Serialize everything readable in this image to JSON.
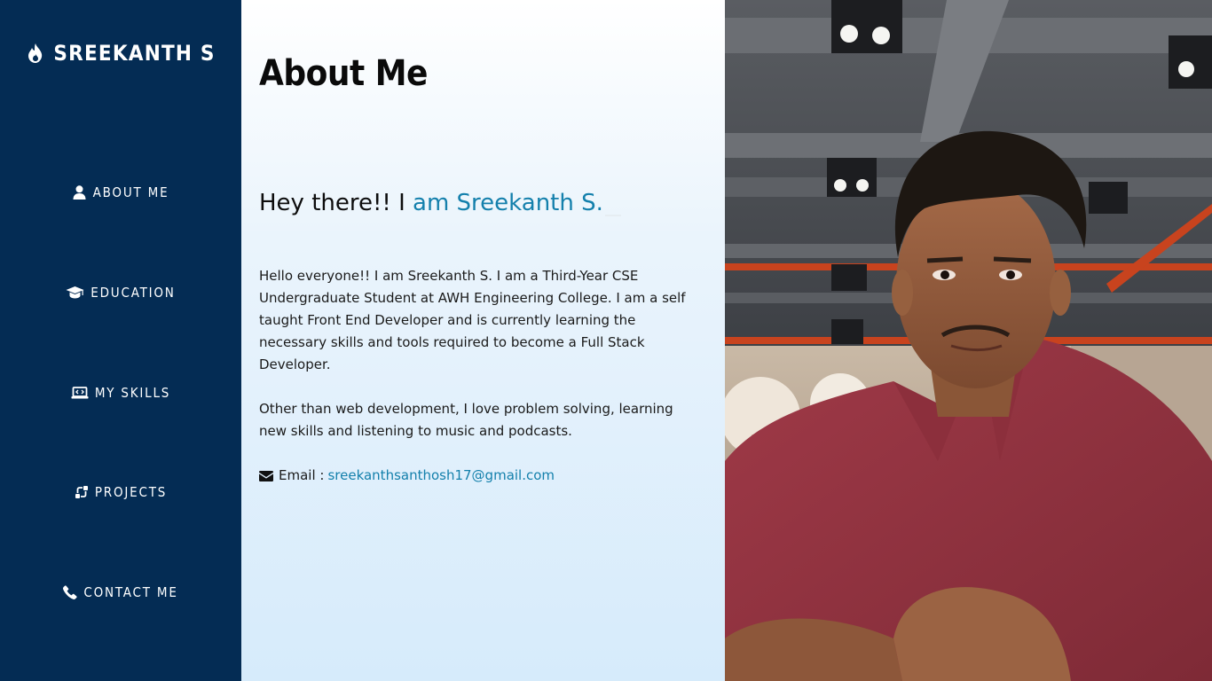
{
  "brand": {
    "name": "SREEKANTH S",
    "icon": "fire-icon"
  },
  "nav": {
    "items": [
      {
        "label": "ABOUT ME",
        "icon": "user-icon"
      },
      {
        "label": "EDUCATION",
        "icon": "graduation-cap-icon"
      },
      {
        "label": "MY SKILLS",
        "icon": "laptop-code-icon"
      },
      {
        "label": "PROJECTS",
        "icon": "project-diagram-icon"
      },
      {
        "label": "CONTACT ME",
        "icon": "phone-icon"
      }
    ]
  },
  "main": {
    "title": "About Me",
    "greeting_prefix": "Hey there!! I",
    "greeting_accent": "am Sreekanth S.",
    "paragraph_1": "Hello everyone!! I am Sreekanth S. I am a Third-Year CSE Undergraduate Student at AWH Engineering College. I am a self taught Front End Developer and is currently learning the necessary skills and tools required to become a Full Stack Developer.",
    "paragraph_2": "Other than web development, I love problem solving, learning new skills and listening to music and podcasts.",
    "email_label": "Email :",
    "email_value": "sreekanthsanthosh17@gmail.com"
  },
  "colors": {
    "sidebar_bg": "#042c54",
    "accent": "#1480ac",
    "text": "#1a1a1a"
  },
  "photo": {
    "subject": "profile-photo"
  }
}
